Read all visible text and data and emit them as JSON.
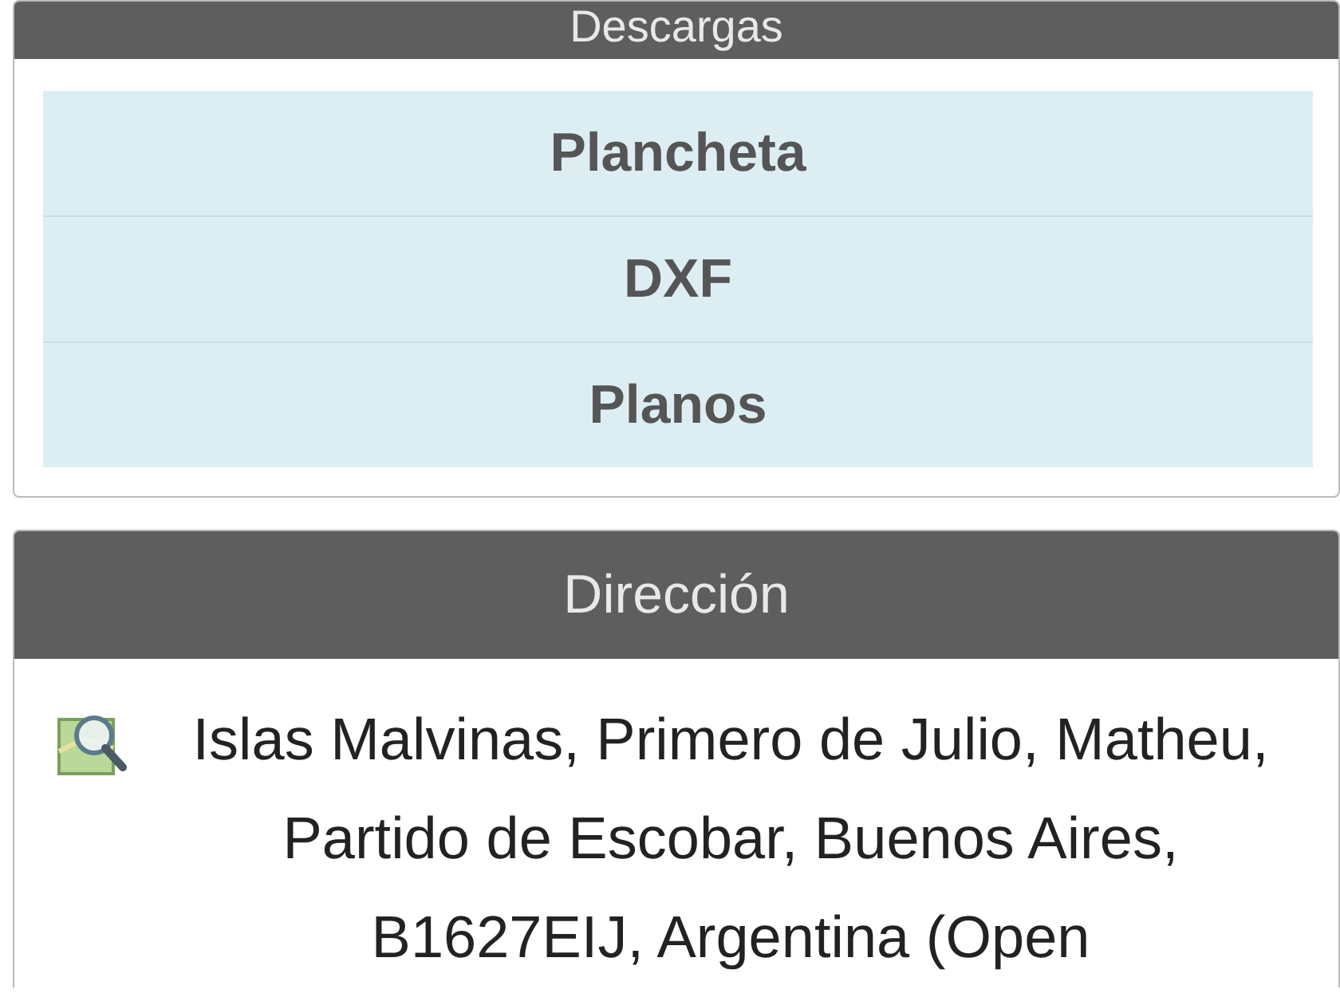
{
  "downloads": {
    "title": "Descargas",
    "links": [
      "Plancheta",
      "DXF",
      "Planos"
    ]
  },
  "address": {
    "title": "Dirección",
    "text": "Islas Malvinas, Primero de Julio, Matheu, Partido de Escobar, Buenos Aires, B1627EIJ, Argentina (Open"
  }
}
